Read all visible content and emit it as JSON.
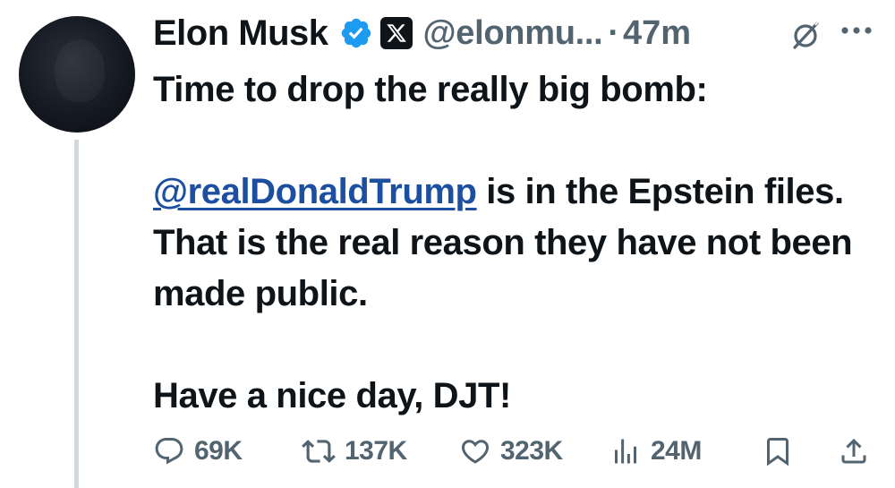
{
  "author": {
    "name": "Elon Musk",
    "handle": "@elonmu...",
    "separator": "·",
    "time": "47m"
  },
  "icons": {
    "verified": "verified-badge-icon",
    "affiliate": "x-logo-icon",
    "grok": "grok-icon",
    "more": "more-options-icon",
    "reply": "reply-icon",
    "repost": "repost-icon",
    "like": "heart-icon",
    "views": "views-icon",
    "bookmark": "bookmark-icon",
    "share": "share-icon"
  },
  "colors": {
    "verified": "#1d9bf0",
    "text": "#0f1419",
    "muted": "#536471",
    "mention": "#1d4fa0",
    "thread_line": "#cfd9de"
  },
  "tweet": {
    "line1": "Time to drop the really big bomb:",
    "mention": "@realDonaldTrump",
    "line2_rest": " is in the Epstein files. That is the real reason they have not been made public.",
    "line3": "Have a nice day, DJT!"
  },
  "actions": {
    "replies": "69K",
    "reposts": "137K",
    "likes": "323K",
    "views": "24M"
  }
}
